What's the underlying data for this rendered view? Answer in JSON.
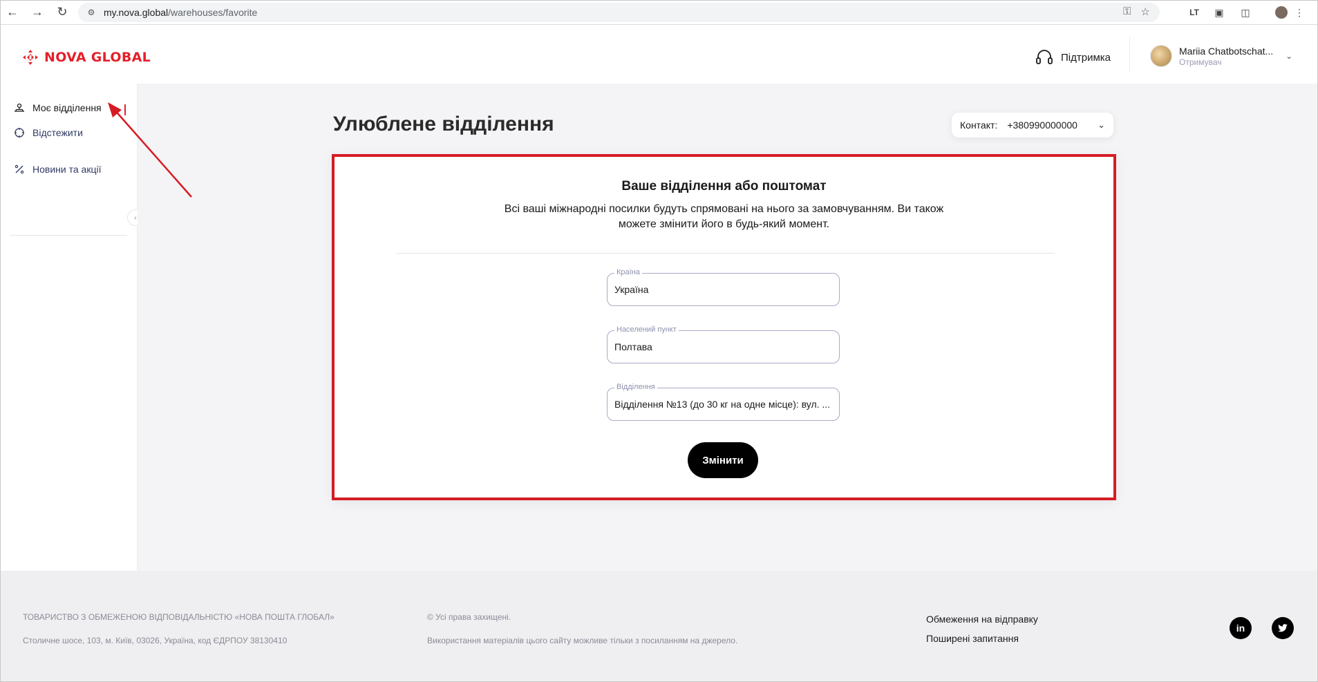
{
  "browser": {
    "url_host": "my.nova.global",
    "url_path": "/warehouses/favorite"
  },
  "header": {
    "logo_text": "NOVA GLOBAL",
    "support_label": "Підтримка",
    "user_name": "Mariia Chatbotschat...",
    "user_role": "Отримувач"
  },
  "sidebar": {
    "items": [
      {
        "label": "Моє відділення",
        "icon": "map-pin-icon",
        "active": true
      },
      {
        "label": "Відстежити",
        "icon": "crosshair-icon",
        "active": false
      },
      {
        "label": "Новини та акції",
        "icon": "percent-icon",
        "active": false
      }
    ]
  },
  "main": {
    "page_title": "Улюблене відділення",
    "contact_label": "Контакт:",
    "contact_value": "+380990000000",
    "card": {
      "title": "Ваше відділення або поштомат",
      "description": "Всі ваші міжнародні посилки будуть спрямовані на нього за замовчуванням. Ви також можете змінити його в будь-який момент.",
      "fields": [
        {
          "label": "Країна",
          "value": "Україна"
        },
        {
          "label": "Населений пункт",
          "value": "Полтава"
        },
        {
          "label": "Відділення",
          "value": "Відділення №13 (до 30 кг на одне місце): вул. ..."
        }
      ],
      "button_label": "Змінити"
    }
  },
  "footer": {
    "company": "ТОВАРИСТВО З ОБМЕЖЕНОЮ ВІДПОВІДАЛЬНІСТЮ «НОВА ПОШТА ГЛОБАЛ»",
    "address": "Столичне шосе, 103, м. Київ, 03026, Україна, код ЄДРПОУ 38130410",
    "rights": "© Усі права захищені.",
    "usage": "Використання матеріалів цього сайту можливе тільки з посиланням на джерело.",
    "links": [
      "Обмеження на відправку",
      "Поширені запитання"
    ],
    "social": [
      "linkedin-icon",
      "twitter-icon"
    ]
  },
  "colors": {
    "brand_red": "#e3202a",
    "highlight_red": "#d51c24",
    "button_black": "#000000"
  }
}
